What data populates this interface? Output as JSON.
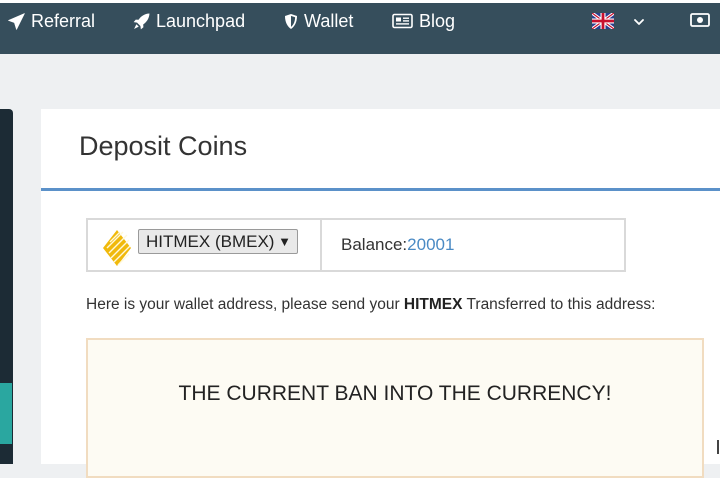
{
  "nav": {
    "items": [
      {
        "label": "Referral",
        "icon": "paper-plane-icon"
      },
      {
        "label": "Launchpad",
        "icon": "rocket-icon"
      },
      {
        "label": "Wallet",
        "icon": "shield-icon"
      },
      {
        "label": "Blog",
        "icon": "newspaper-icon"
      }
    ],
    "language_icon": "uk-flag-icon"
  },
  "deposit": {
    "title": "Deposit Coins",
    "coin_selected": "HITMEX (BMEX)",
    "balance_label": "Balance:",
    "balance_value": "20001",
    "info_prefix": "Here is your wallet address, please send your ",
    "info_coin": "HITMEX",
    "info_suffix": " Transferred to this address:",
    "notice": "THE CURRENT BAN INTO THE CURRENCY!"
  },
  "colors": {
    "topbar": "#364e5c",
    "accent_blue": "#5b91c9",
    "balance_value": "#4a8ac4",
    "teal": "#2aa7a0",
    "coin_gold": "#f0b90b"
  }
}
